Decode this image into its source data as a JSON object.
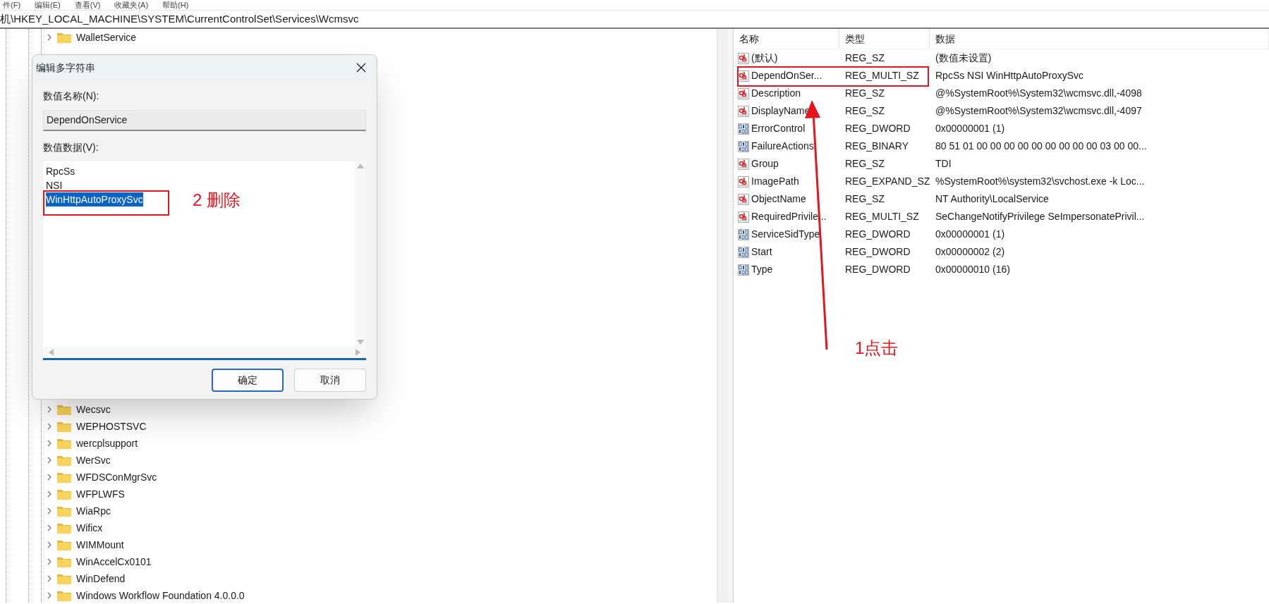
{
  "menu_bar": [
    {
      "label": "件(F)"
    },
    {
      "label": "编辑(E)"
    },
    {
      "label": "查看(V)"
    },
    {
      "label": "收藏夹(A)"
    },
    {
      "label": "帮助(H)"
    }
  ],
  "address_bar": {
    "path": "机\\HKEY_LOCAL_MACHINE\\SYSTEM\\CurrentControlSet\\Services\\Wcmsvc"
  },
  "tree": {
    "top_items": [
      {
        "label": "WalletService"
      }
    ],
    "bottom_items": [
      {
        "label": "Wecsvc"
      },
      {
        "label": "WEPHOSTSVC"
      },
      {
        "label": "wercplsupport"
      },
      {
        "label": "WerSvc"
      },
      {
        "label": "WFDSConMgrSvc"
      },
      {
        "label": "WFPLWFS"
      },
      {
        "label": "WiaRpc"
      },
      {
        "label": "Wificx"
      },
      {
        "label": "WIMMount"
      },
      {
        "label": "WinAccelCx0101"
      },
      {
        "label": "WinDefend"
      },
      {
        "label": "Windows Workflow Foundation 4.0.0.0"
      }
    ]
  },
  "values": {
    "columns": [
      "名称",
      "类型",
      "数据"
    ],
    "rows": [
      {
        "kind": "string",
        "name": "(默认)",
        "type": "REG_SZ",
        "data": "(数值未设置)"
      },
      {
        "kind": "string",
        "name": "DependOnSer...",
        "type": "REG_MULTI_SZ",
        "data": "RpcSs NSI WinHttpAutoProxySvc"
      },
      {
        "kind": "string",
        "name": "Description",
        "type": "REG_SZ",
        "data": "@%SystemRoot%\\System32\\wcmsvc.dll,-4098"
      },
      {
        "kind": "string",
        "name": "DisplayName",
        "type": "REG_SZ",
        "data": "@%SystemRoot%\\System32\\wcmsvc.dll,-4097"
      },
      {
        "kind": "binary",
        "name": "ErrorControl",
        "type": "REG_DWORD",
        "data": "0x00000001 (1)"
      },
      {
        "kind": "binary",
        "name": "FailureActions",
        "type": "REG_BINARY",
        "data": "80 51 01 00 00 00 00 00 00 00 00 00 03 00 00..."
      },
      {
        "kind": "string",
        "name": "Group",
        "type": "REG_SZ",
        "data": "TDI"
      },
      {
        "kind": "string",
        "name": "ImagePath",
        "type": "REG_EXPAND_SZ",
        "data": "%SystemRoot%\\system32\\svchost.exe -k Loc..."
      },
      {
        "kind": "string",
        "name": "ObjectName",
        "type": "REG_SZ",
        "data": "NT Authority\\LocalService"
      },
      {
        "kind": "string",
        "name": "RequiredPrivile...",
        "type": "REG_MULTI_SZ",
        "data": "SeChangeNotifyPrivilege SeImpersonatePrivil..."
      },
      {
        "kind": "binary",
        "name": "ServiceSidType",
        "type": "REG_DWORD",
        "data": "0x00000001 (1)"
      },
      {
        "kind": "binary",
        "name": "Start",
        "type": "REG_DWORD",
        "data": "0x00000002 (2)"
      },
      {
        "kind": "binary",
        "name": "Type",
        "type": "REG_DWORD",
        "data": "0x00000010 (16)"
      }
    ]
  },
  "dialog": {
    "title": "编辑多字符串",
    "name_label": "数值名称(N):",
    "name_value": "DependOnService",
    "data_label": "数值数据(V):",
    "data_lines": [
      {
        "text": "RpcSs",
        "selected": false
      },
      {
        "text": "NSI",
        "selected": false
      },
      {
        "text": "WinHttpAutoProxySvc",
        "selected": true
      }
    ],
    "buttons": [
      {
        "label": "确定",
        "default": true
      },
      {
        "label": "取消",
        "default": false
      }
    ]
  },
  "annotations": {
    "delete_note": "2 删除",
    "click_note": "1点击"
  }
}
